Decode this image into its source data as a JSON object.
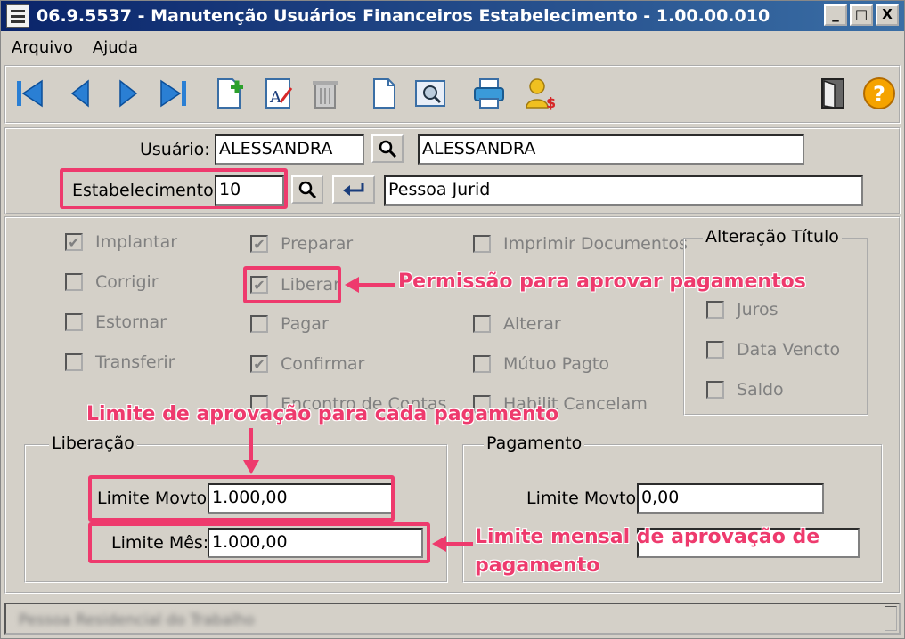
{
  "window": {
    "title": "06.9.5537 - Manutenção Usuários Financeiros Estabelecimento - 1.00.00.010",
    "controls": [
      "_",
      "□",
      "X"
    ]
  },
  "menu": [
    "Arquivo",
    "Ajuda"
  ],
  "toolbar": {
    "icons": [
      "first-record-icon",
      "prev-record-icon",
      "next-record-icon",
      "last-record-icon",
      "new-record-icon",
      "edit-record-icon",
      "delete-icon",
      "blank-document-icon",
      "preview-icon",
      "print-icon",
      "user-money-icon",
      "exit-door-icon",
      "help-icon"
    ]
  },
  "header": {
    "usuario_label": "Usuário:",
    "usuario_code": "ALESSANDRA",
    "usuario_name": "ALESSANDRA",
    "estab_label": "Estabelecimento:",
    "estab_code": "10",
    "estab_name": "Pessoa Jurid"
  },
  "permissions": {
    "col1": [
      {
        "label": "Implantar",
        "checked": true
      },
      {
        "label": "Corrigir",
        "checked": false
      },
      {
        "label": "Estornar",
        "checked": false
      },
      {
        "label": "Transferir",
        "checked": false
      }
    ],
    "col2": [
      {
        "label": "Preparar",
        "checked": true
      },
      {
        "label": "Liberar",
        "checked": true
      },
      {
        "label": "Pagar",
        "checked": false
      },
      {
        "label": "Confirmar",
        "checked": true
      },
      {
        "label": "Encontro de Contas",
        "checked": false
      }
    ],
    "col3": [
      {
        "label": "Imprimir Documentos",
        "checked": false
      },
      {
        "label": "",
        "checked": false
      },
      {
        "label": "Alterar",
        "checked": false
      },
      {
        "label": "Mútuo Pagto",
        "checked": false
      },
      {
        "label": "Habilit Cancelam",
        "checked": false
      }
    ],
    "alteracao": {
      "title": "Alteração Título",
      "items": [
        {
          "label": "Juros",
          "checked": false
        },
        {
          "label": "Data Vencto",
          "checked": false
        },
        {
          "label": "Saldo",
          "checked": false
        }
      ]
    }
  },
  "liberacao": {
    "title": "Liberação",
    "limite_movto_label": "Limite Movto:",
    "limite_movto": "1.000,00",
    "limite_mes_label": "Limite Mês:",
    "limite_mes": "1.000,00"
  },
  "pagamento": {
    "title": "Pagamento",
    "limite_movto_label": "Limite Movto:",
    "limite_movto": "0,00"
  },
  "annotations": {
    "permissao": "Permissão para aprovar pagamentos",
    "limite_cada": "Limite de aprovação para cada pagamento",
    "limite_mensal_1": "Limite mensal de aprovação de",
    "limite_mensal_2": "pagamento",
    "color": "#ee3a6d"
  },
  "status": {
    "text": "Pessoa Residencial do Trabalho"
  }
}
